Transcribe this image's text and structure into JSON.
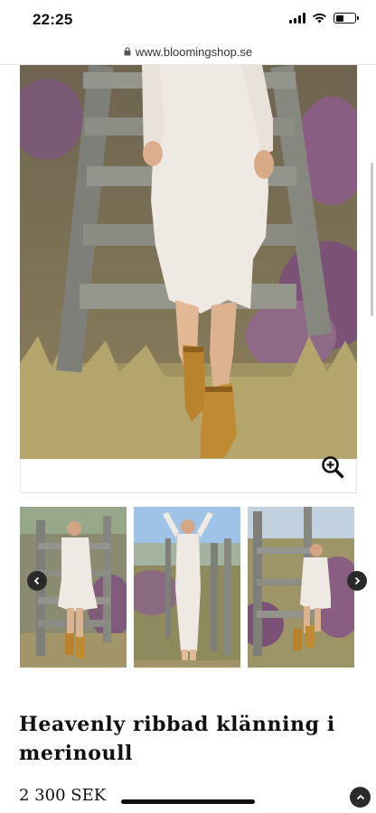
{
  "status_bar": {
    "time": "22:25",
    "icons": [
      "cellular-signal-icon",
      "wifi-icon",
      "battery-icon"
    ]
  },
  "browser": {
    "url": "www.bloomingshop.se",
    "icons": [
      "lock-icon"
    ]
  },
  "product": {
    "title": "Heavenly ribbad klänning i merinoull",
    "price": "2 300 SEK"
  },
  "gallery": {
    "main_image": "photo of woman in white ribbed dress sitting on wooden stairs with heather",
    "thumbnails": [
      "woman in white ribbed dress sitting on wooden stairs",
      "woman in white ribbed dress standing with arms raised",
      "woman in white ribbed dress sitting on wooden stairs in heather"
    ],
    "icons": [
      "zoom-in-icon",
      "chevron-left-icon",
      "chevron-right-icon",
      "chevron-up-icon"
    ]
  },
  "colors": {
    "text": "#111111",
    "dark_button": "#2a2a2a",
    "dress_white": "#eee8e2",
    "heather_purple": "#8a5d83",
    "grass": "#9a9060",
    "sky": "#9fc3e6"
  }
}
